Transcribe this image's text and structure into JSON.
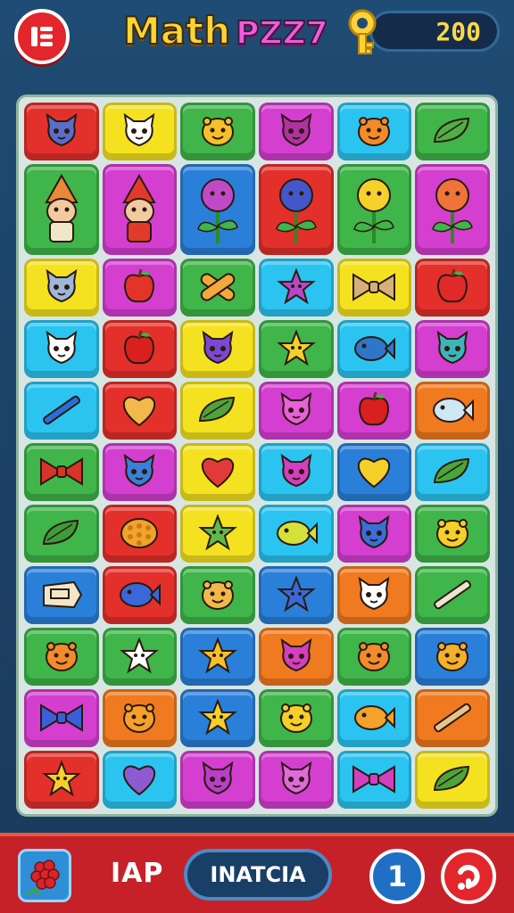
{
  "header": {
    "title_main": "Math",
    "title_sub": "PZZ7",
    "score": "200",
    "pause_icon": "pause-menu-icon",
    "key_icon": "key-icon"
  },
  "footer": {
    "lap_label": "IAP",
    "action_label": "INATCIA",
    "count": "1",
    "powerup_icon": "berry-powerup-icon",
    "help_icon": "refresh-question-icon"
  },
  "colors": {
    "red": "#e3302b",
    "yellow": "#f4e221",
    "green": "#3fb54a",
    "magenta": "#d43fd0",
    "cyan": "#2bc4f0",
    "blue": "#2a7fd8",
    "orange": "#f07a1f"
  },
  "board": {
    "rows": [
      [
        {
          "color": "red",
          "icon": "cat",
          "fg": "#5a6ec9"
        },
        {
          "color": "yellow",
          "icon": "cat",
          "fg": "#ffffff"
        },
        {
          "color": "green",
          "icon": "face",
          "fg": "#f5c02a"
        },
        {
          "color": "magenta",
          "icon": "cat",
          "fg": "#b0329e"
        },
        {
          "color": "cyan",
          "icon": "face",
          "fg": "#f28b2a"
        },
        {
          "color": "green",
          "icon": "leaf",
          "fg": "#4fae44"
        }
      ],
      [
        {
          "color": "green",
          "icon": "gnome",
          "fg": "#e8893a"
        },
        {
          "color": "magenta",
          "icon": "gnome",
          "fg": "#f3c9a0"
        },
        {
          "color": "blue",
          "icon": "flower",
          "fg": "#c04ac6"
        },
        {
          "color": "red",
          "icon": "flower",
          "fg": "#4457c8"
        },
        {
          "color": "green",
          "icon": "flower",
          "fg": "#f5d12b"
        },
        {
          "color": "magenta",
          "icon": "flower",
          "fg": "#f0743a"
        }
      ],
      [
        {
          "color": "yellow",
          "icon": "cat",
          "fg": "#9fb6d9"
        },
        {
          "color": "magenta",
          "icon": "apple",
          "fg": "#e4342a"
        },
        {
          "color": "green",
          "icon": "cross",
          "fg": "#f2a83a"
        },
        {
          "color": "cyan",
          "icon": "star",
          "fg": "#b847c8"
        },
        {
          "color": "yellow",
          "icon": "bow",
          "fg": "#d5b07a"
        },
        {
          "color": "red",
          "icon": "apple",
          "fg": "#e02a2a"
        }
      ],
      [
        {
          "color": "cyan",
          "icon": "cat",
          "fg": "#ffffff"
        },
        {
          "color": "red",
          "icon": "apple",
          "fg": "#d8201f"
        },
        {
          "color": "yellow",
          "icon": "cat",
          "fg": "#7b48d0"
        },
        {
          "color": "green",
          "icon": "star",
          "fg": "#f5cf2a"
        },
        {
          "color": "cyan",
          "icon": "fish",
          "fg": "#2e77c8"
        },
        {
          "color": "magenta",
          "icon": "cat",
          "fg": "#3fb4b8"
        }
      ],
      [
        {
          "color": "cyan",
          "icon": "pen",
          "fg": "#2a6fd8"
        },
        {
          "color": "red",
          "icon": "heart",
          "fg": "#f2b84a"
        },
        {
          "color": "yellow",
          "icon": "leaf",
          "fg": "#4ea43a"
        },
        {
          "color": "magenta",
          "icon": "cat",
          "fg": "#e861d8"
        },
        {
          "color": "magenta",
          "icon": "apple",
          "fg": "#d8201f"
        },
        {
          "color": "orange",
          "icon": "fish",
          "fg": "#cfe6f5"
        }
      ],
      [
        {
          "color": "green",
          "icon": "bow",
          "fg": "#d8342a"
        },
        {
          "color": "magenta",
          "icon": "cat",
          "fg": "#3a7fd8"
        },
        {
          "color": "yellow",
          "icon": "heart",
          "fg": "#e23a3a"
        },
        {
          "color": "cyan",
          "icon": "cat",
          "fg": "#d23fbf"
        },
        {
          "color": "blue",
          "icon": "heart",
          "fg": "#f5cf2a"
        },
        {
          "color": "cyan",
          "icon": "leaf",
          "fg": "#49a63a"
        }
      ],
      [
        {
          "color": "green",
          "icon": "leaf",
          "fg": "#3d9d3a"
        },
        {
          "color": "red",
          "icon": "corn",
          "fg": "#f2a32a"
        },
        {
          "color": "yellow",
          "icon": "star",
          "fg": "#5ebb4a"
        },
        {
          "color": "cyan",
          "icon": "fish",
          "fg": "#d6e03a"
        },
        {
          "color": "magenta",
          "icon": "cat",
          "fg": "#3a6fd8"
        },
        {
          "color": "green",
          "icon": "face",
          "fg": "#f5cf2a"
        }
      ],
      [
        {
          "color": "blue",
          "icon": "tag",
          "fg": "#f2e6c8"
        },
        {
          "color": "red",
          "icon": "fish",
          "fg": "#3a68d8"
        },
        {
          "color": "green",
          "icon": "face",
          "fg": "#f2b84a"
        },
        {
          "color": "blue",
          "icon": "star",
          "fg": "#3a68d8"
        },
        {
          "color": "orange",
          "icon": "cat",
          "fg": "#ffffff"
        },
        {
          "color": "green",
          "icon": "pen",
          "fg": "#e8e4d0"
        }
      ],
      [
        {
          "color": "green",
          "icon": "face",
          "fg": "#f28b2a"
        },
        {
          "color": "green",
          "icon": "star",
          "fg": "#ffffff"
        },
        {
          "color": "blue",
          "icon": "star",
          "fg": "#f5c02a"
        },
        {
          "color": "orange",
          "icon": "cat",
          "fg": "#d23fbf"
        },
        {
          "color": "green",
          "icon": "face",
          "fg": "#f28b2a"
        },
        {
          "color": "blue",
          "icon": "face",
          "fg": "#f5b02a"
        }
      ],
      [
        {
          "color": "magenta",
          "icon": "bow",
          "fg": "#3a5fd8"
        },
        {
          "color": "orange",
          "icon": "face",
          "fg": "#f5a02a"
        },
        {
          "color": "blue",
          "icon": "star",
          "fg": "#f5cf2a"
        },
        {
          "color": "green",
          "icon": "face",
          "fg": "#f5cf2a"
        },
        {
          "color": "cyan",
          "icon": "fish",
          "fg": "#f2a32a"
        },
        {
          "color": "orange",
          "icon": "pen",
          "fg": "#e8c48a"
        }
      ],
      [
        {
          "color": "red",
          "icon": "star",
          "fg": "#f5cf2a"
        },
        {
          "color": "cyan",
          "icon": "heart",
          "fg": "#8e5ad0"
        },
        {
          "color": "magenta",
          "icon": "cat",
          "fg": "#b83fc8"
        },
        {
          "color": "magenta",
          "icon": "cat",
          "fg": "#e06ad8"
        },
        {
          "color": "cyan",
          "icon": "bow",
          "fg": "#d23fbf"
        },
        {
          "color": "yellow",
          "icon": "leaf",
          "fg": "#4ea43a"
        }
      ]
    ]
  }
}
